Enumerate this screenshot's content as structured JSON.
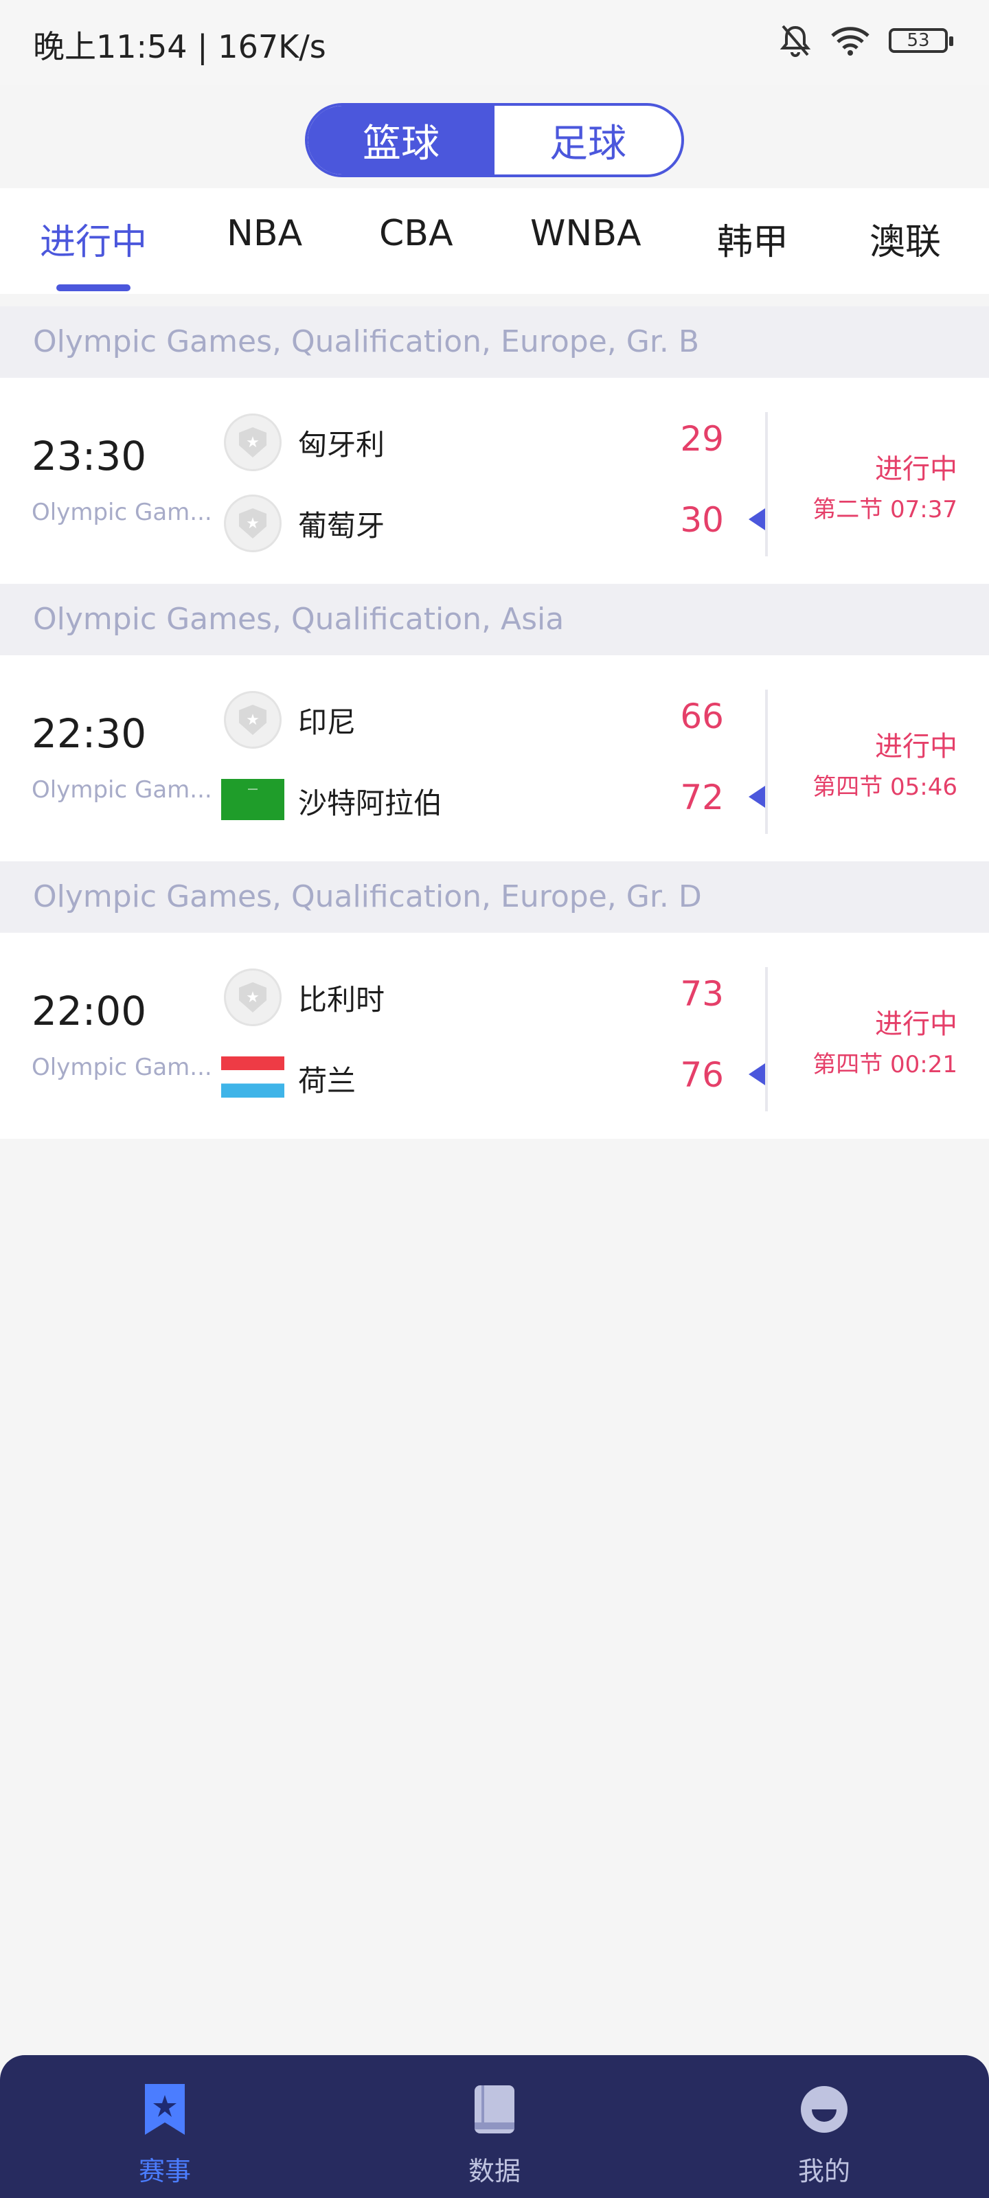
{
  "status_bar": {
    "time": "晚上11:54 | 167K/s",
    "battery": "53"
  },
  "sport_switch": {
    "options": [
      "篮球",
      "足球"
    ],
    "selected": "篮球"
  },
  "tabs": [
    "进行中",
    "NBA",
    "CBA",
    "WNBA",
    "韩甲",
    "澳联"
  ],
  "groups": [
    {
      "header": "Olympic Games, Qualification, Europe, Gr. B",
      "match": {
        "time": "23:30",
        "league": "Olympic Gam...",
        "home": {
          "name": "匈牙利",
          "score": "29"
        },
        "away": {
          "name": "葡萄牙",
          "score": "30"
        },
        "status": "进行中",
        "clock": "第二节 07:37"
      }
    },
    {
      "header": "Olympic Games, Qualification, Asia",
      "match": {
        "time": "22:30",
        "league": "Olympic Gam...",
        "home": {
          "name": "印尼",
          "score": "66"
        },
        "away": {
          "name": "沙特阿拉伯",
          "score": "72"
        },
        "status": "进行中",
        "clock": "第四节 05:46"
      }
    },
    {
      "header": "Olympic Games, Qualification, Europe, Gr. D",
      "match": {
        "time": "22:00",
        "league": "Olympic Gam...",
        "home": {
          "name": "比利时",
          "score": "73"
        },
        "away": {
          "name": "荷兰",
          "score": "76"
        },
        "status": "进行中",
        "clock": "第四节 00:21"
      }
    }
  ],
  "bottom_nav": [
    {
      "label": "赛事",
      "icon": "events-icon",
      "active": true
    },
    {
      "label": "数据",
      "icon": "data-book-icon",
      "active": false
    },
    {
      "label": "我的",
      "icon": "profile-icon",
      "active": false
    }
  ],
  "colors": {
    "accent": "#4b57dc",
    "score": "#e53f69",
    "nav_bg": "#272b5f"
  }
}
